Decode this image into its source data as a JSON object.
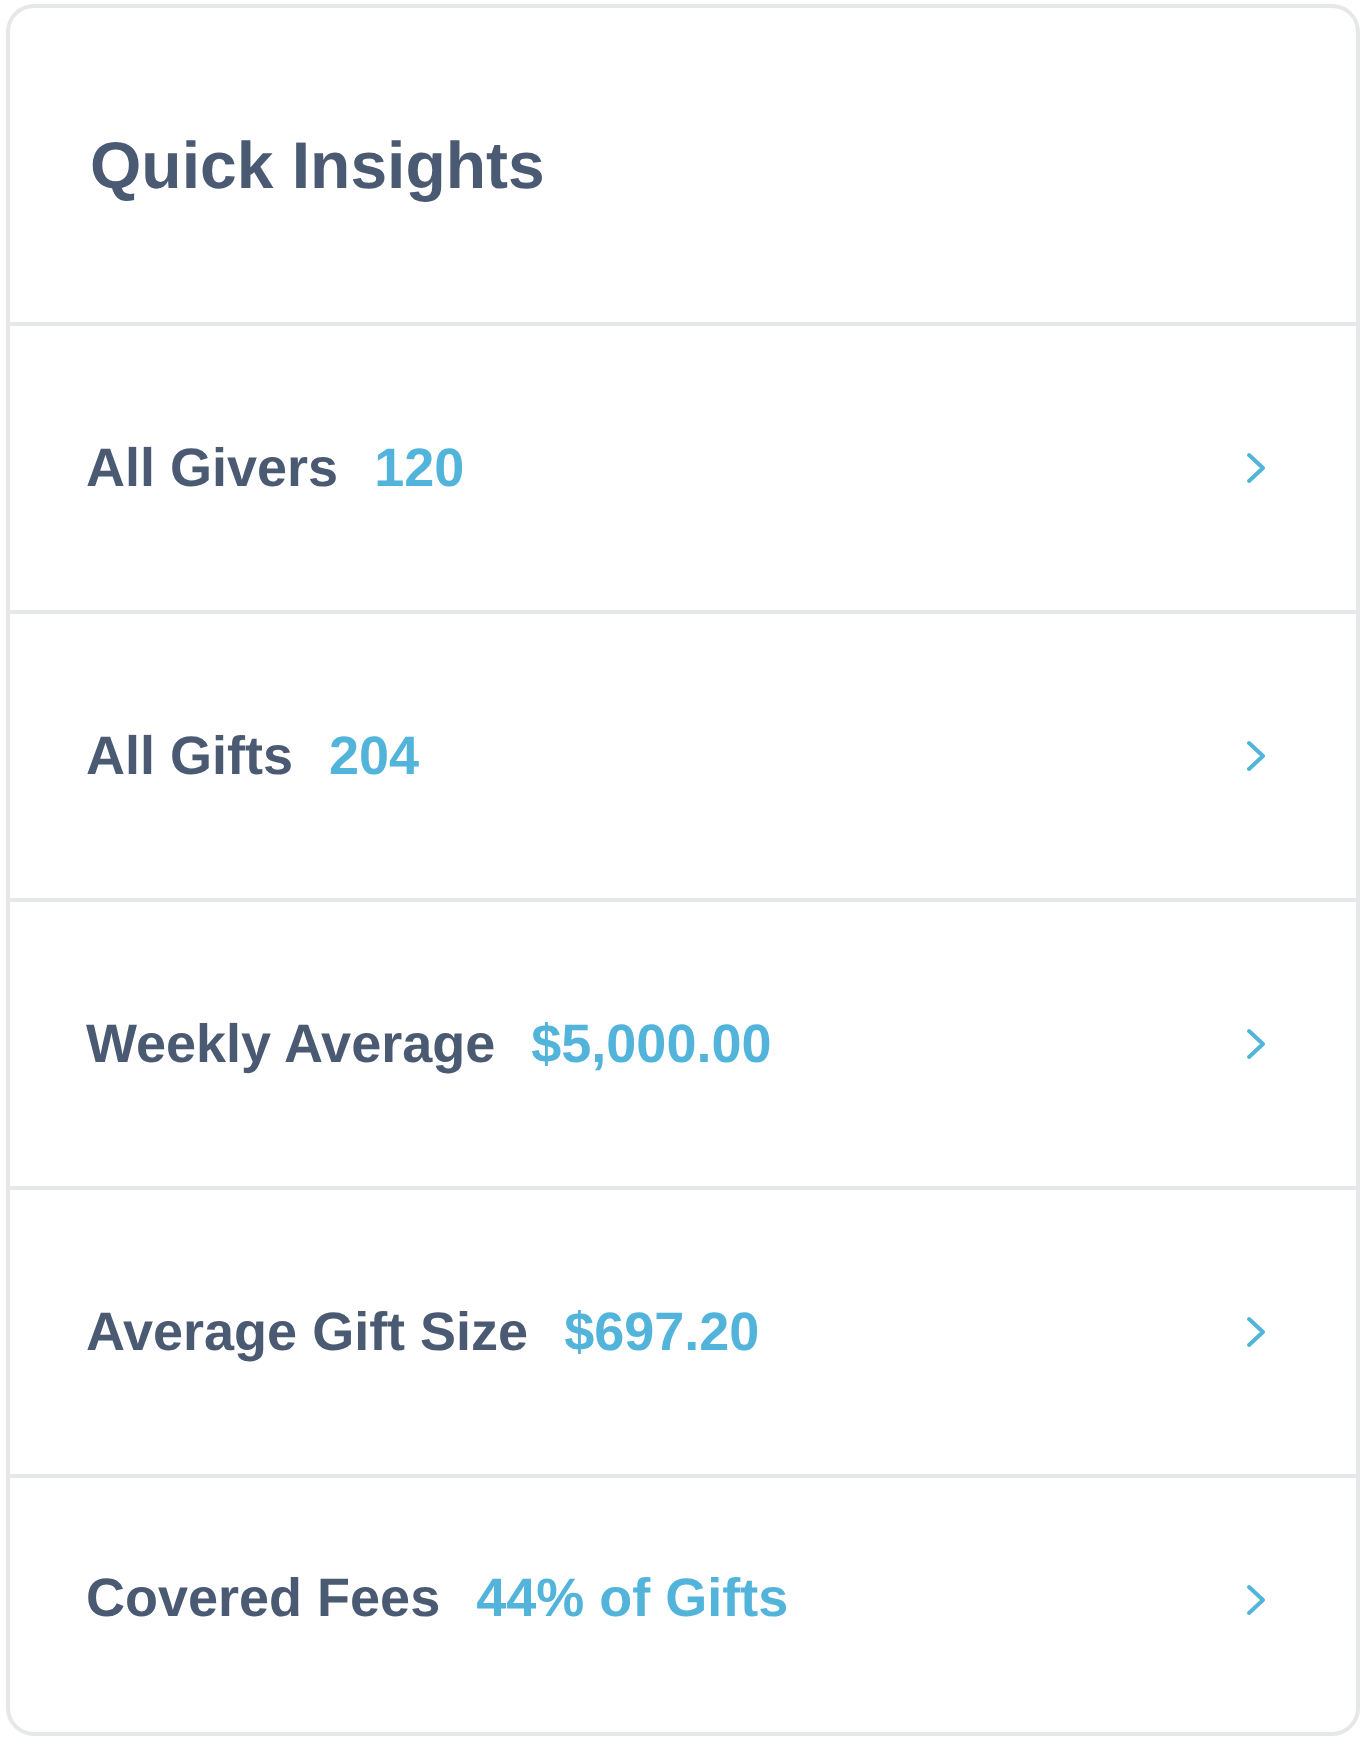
{
  "card": {
    "title": "Quick Insights"
  },
  "insights": [
    {
      "label": "All Givers",
      "value": "120"
    },
    {
      "label": "All Gifts",
      "value": "204"
    },
    {
      "label": "Weekly Average",
      "value": "$5,000.00"
    },
    {
      "label": "Average Gift Size",
      "value": "$697.20"
    },
    {
      "label": "Covered Fees",
      "value": "44% of Gifts"
    }
  ]
}
